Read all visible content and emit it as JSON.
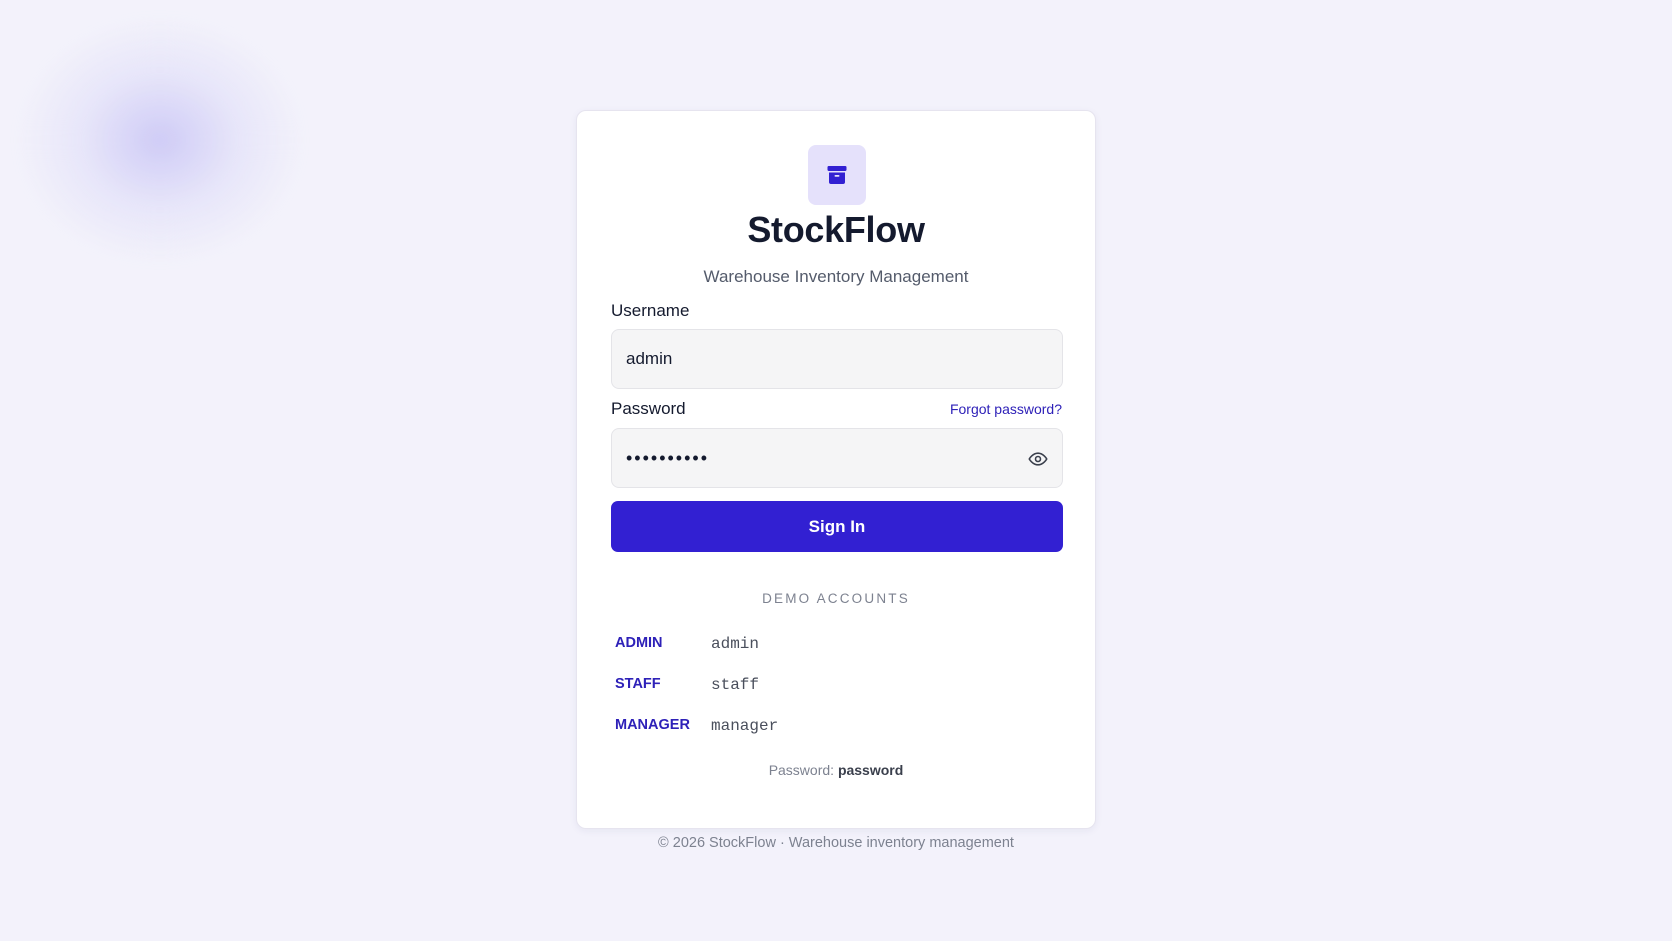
{
  "app": {
    "name": "StockFlow",
    "tagline": "Warehouse Inventory Management",
    "logo_icon": "archive-box-icon",
    "accent_color": "#3220d2"
  },
  "form": {
    "username_label": "Username",
    "username_value": "admin",
    "password_label": "Password",
    "password_value": "••••••••••",
    "forgot_password": "Forgot password?",
    "toggle_visibility_icon": "eye-icon",
    "submit_label": "Sign In"
  },
  "demo": {
    "heading": "DEMO ACCOUNTS",
    "accounts": [
      {
        "role": "ADMIN",
        "username": "admin"
      },
      {
        "role": "STAFF",
        "username": "staff"
      },
      {
        "role": "MANAGER",
        "username": "manager"
      }
    ],
    "password_prefix": "Password:",
    "password_value": "password"
  },
  "footer": {
    "text": "© 2026 StockFlow · Warehouse inventory management"
  }
}
